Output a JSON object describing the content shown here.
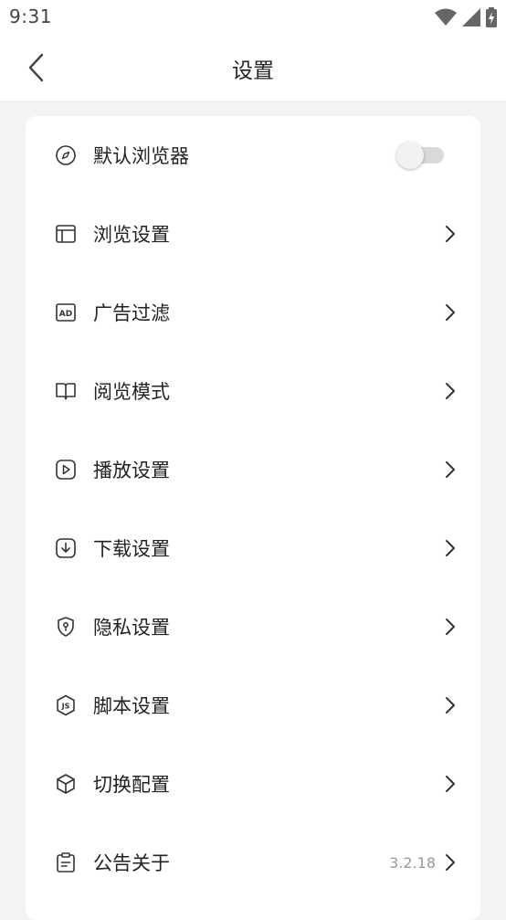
{
  "status_bar": {
    "time": "9:31",
    "icons": [
      "wifi-icon",
      "signal-icon",
      "battery-charging-icon"
    ]
  },
  "header": {
    "title": "设置",
    "back_icon": "chevron-left-icon"
  },
  "settings": {
    "items": [
      {
        "label": "默认浏览器",
        "icon": "compass-icon",
        "control": "toggle",
        "toggle_on": false
      },
      {
        "label": "浏览设置",
        "icon": "layout-icon",
        "control": "chevron"
      },
      {
        "label": "广告过滤",
        "icon": "ad-icon",
        "control": "chevron"
      },
      {
        "label": "阅览模式",
        "icon": "book-icon",
        "control": "chevron"
      },
      {
        "label": "播放设置",
        "icon": "play-icon",
        "control": "chevron"
      },
      {
        "label": "下载设置",
        "icon": "download-icon",
        "control": "chevron"
      },
      {
        "label": "隐私设置",
        "icon": "shield-icon",
        "control": "chevron"
      },
      {
        "label": "脚本设置",
        "icon": "js-icon",
        "control": "chevron"
      },
      {
        "label": "切换配置",
        "icon": "cube-icon",
        "control": "chevron"
      },
      {
        "label": "公告关于",
        "icon": "clipboard-icon",
        "control": "chevron",
        "value": "3.2.18"
      }
    ]
  },
  "colors": {
    "background": "#f3f3f3",
    "card": "#ffffff",
    "text": "#222222",
    "secondary_text": "#9a9a9a",
    "toggle_off": "#d9d9d9"
  }
}
